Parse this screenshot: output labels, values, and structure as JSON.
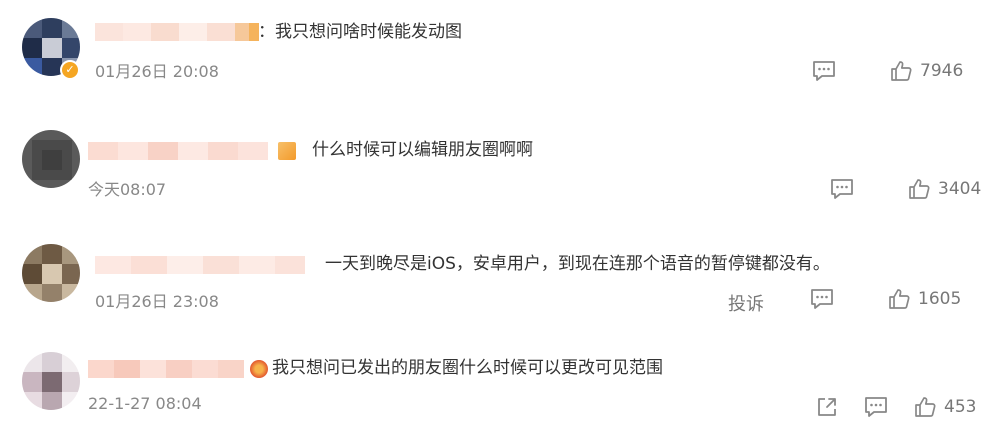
{
  "comments": [
    {
      "text": "：我只想问啥时候能发动图",
      "time": "01月26日 20:08",
      "likes": "7946"
    },
    {
      "text": "什么时候可以编辑朋友圈啊啊",
      "time": "今天08:07",
      "likes": "3404"
    },
    {
      "text": "一天到晚尽是iOS，安卓用户，到现在连那个语音的暂停键都没有。",
      "time": "01月26日 23:08",
      "report": "投诉",
      "likes": "1605"
    },
    {
      "text": "我只想问已发出的朋友圈什么时候可以更改可见范围",
      "time": "22-1-27 08:04",
      "likes": "453"
    }
  ],
  "colors": {
    "text": "#333333",
    "meta": "#888888",
    "icon": "#888888",
    "verified": "#f5a623"
  },
  "icons": [
    "comment-icon",
    "thumbs-up-icon",
    "share-icon",
    "verified-icon"
  ]
}
